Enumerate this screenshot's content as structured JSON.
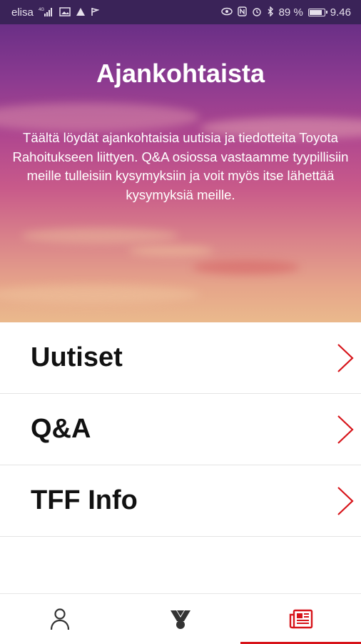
{
  "status_bar": {
    "carrier": "elisa",
    "network": "4G",
    "battery_text": "89 %",
    "battery_level": 0.89,
    "time": "9.46"
  },
  "hero": {
    "title": "Ajankohtaista",
    "description": "Täältä löydät ajankohtaisia uutisia ja tiedotteita Toyota Rahoitukseen liittyen. Q&A osiossa vastaamme tyypillisiin meille tulleisiin kysymyksiin ja voit myös itse lähettää kysymyksiä meille."
  },
  "menu": {
    "items": [
      {
        "label": "Uutiset",
        "icon": "chevron-right-icon"
      },
      {
        "label": "Q&A",
        "icon": "chevron-right-icon"
      },
      {
        "label": "TFF Info",
        "icon": "chevron-right-icon"
      }
    ]
  },
  "bottom_nav": {
    "tabs": [
      {
        "icon": "person-icon",
        "active": false
      },
      {
        "icon": "badge-icon",
        "active": false
      },
      {
        "icon": "newspaper-icon",
        "active": true
      }
    ]
  },
  "colors": {
    "accent": "#d7141a",
    "status_bar_bg": "#3a2358",
    "text": "#111111"
  }
}
